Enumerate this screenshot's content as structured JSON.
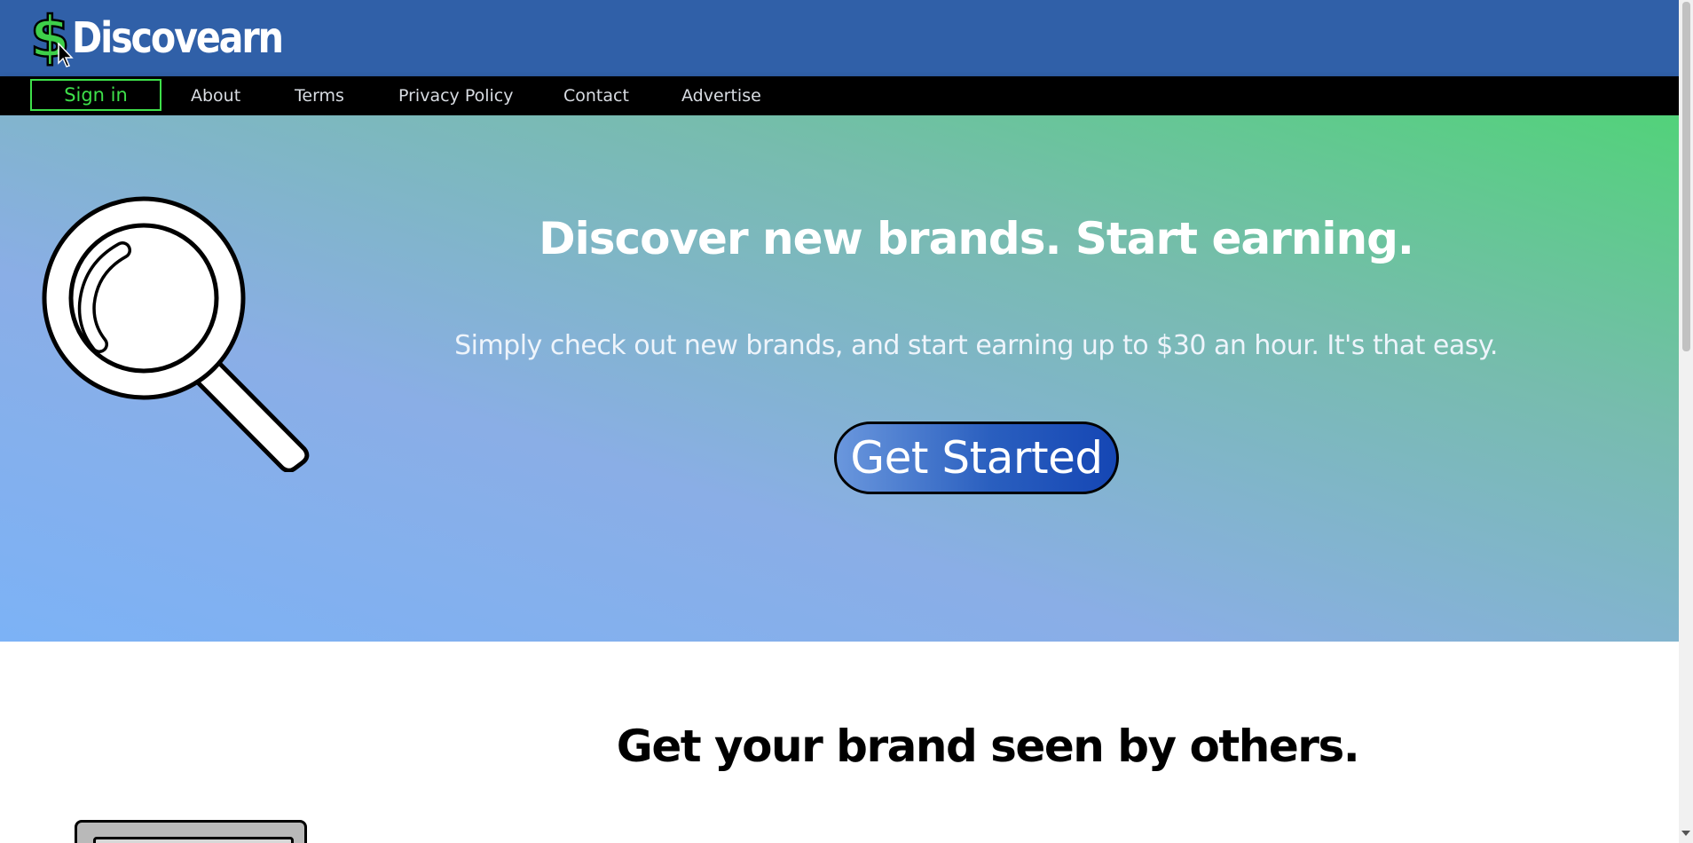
{
  "brand": {
    "dollar": "$",
    "name": "Discovearn",
    "colors": {
      "header": "#3060a8",
      "accent": "#3ee04a"
    }
  },
  "nav": {
    "sign_in": "Sign in",
    "links": [
      "About",
      "Terms",
      "Privacy Policy",
      "Contact",
      "Advertise"
    ]
  },
  "hero": {
    "title": "Discover new brands. Start earning.",
    "subtitle": "Simply check out new brands, and start earning up to $30 an hour. It's that easy.",
    "cta": "Get Started",
    "icon": "magnifier-icon"
  },
  "section2": {
    "title": "Get your brand seen by others."
  }
}
